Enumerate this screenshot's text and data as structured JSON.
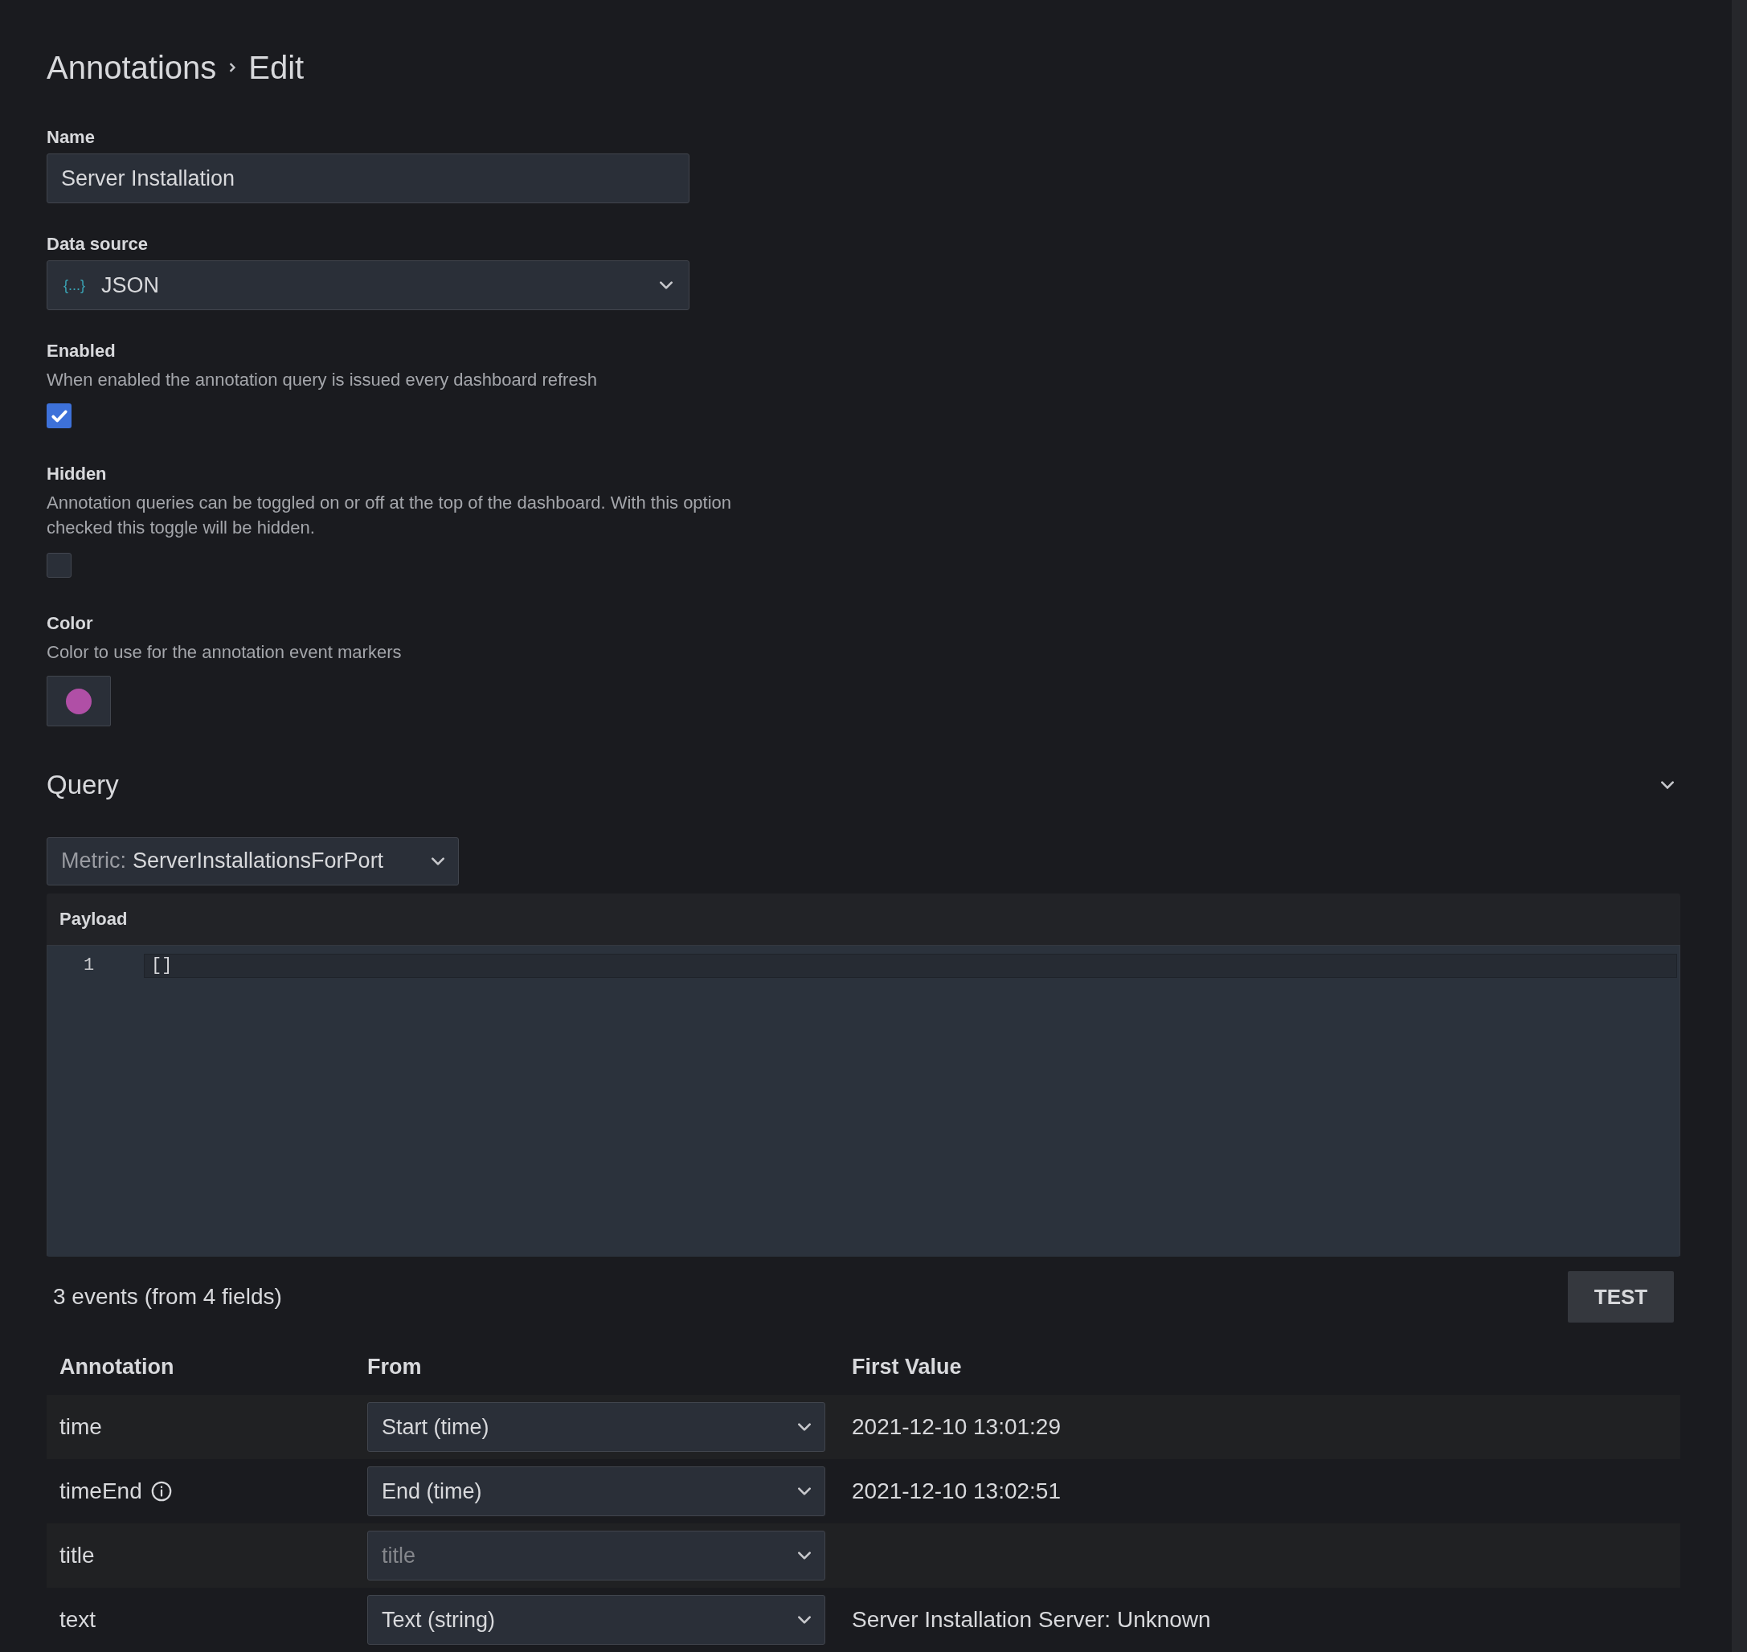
{
  "breadcrumb": [
    "Annotations",
    "Edit"
  ],
  "name": {
    "label": "Name",
    "value": "Server Installation"
  },
  "data_source": {
    "label": "Data source",
    "value": "JSON",
    "icon_text": "{...}"
  },
  "enabled": {
    "label": "Enabled",
    "description": "When enabled the annotation query is issued every dashboard refresh",
    "checked": true
  },
  "hidden": {
    "label": "Hidden",
    "description": "Annotation queries can be toggled on or off at the top of the dashboard. With this option checked this toggle will be hidden.",
    "checked": false
  },
  "color": {
    "label": "Color",
    "description": "Color to use for the annotation event markers",
    "color": "#b04fa6"
  },
  "query": {
    "title": "Query",
    "expanded": true,
    "metric": {
      "label": "Metric:",
      "value": "ServerInstallationsForPort"
    },
    "payload": {
      "label": "Payload",
      "lines": [
        {
          "number": "1",
          "code": "[]"
        }
      ]
    }
  },
  "summary": "3 events (from 4 fields)",
  "test_button": "TEST",
  "table": {
    "columns": [
      "Annotation",
      "From",
      "First Value"
    ],
    "rows": [
      {
        "annotation": "time",
        "info": false,
        "from": "Start (time)",
        "first_value": "2021-12-10 13:01:29"
      },
      {
        "annotation": "timeEnd",
        "info": true,
        "from": "End (time)",
        "first_value": "2021-12-10 13:02:51"
      },
      {
        "annotation": "title",
        "info": false,
        "placeholder": "title"
      },
      {
        "annotation": "text",
        "info": false,
        "from": "Text (string)",
        "first_value": "Server Installation Server: Unknown"
      }
    ]
  }
}
